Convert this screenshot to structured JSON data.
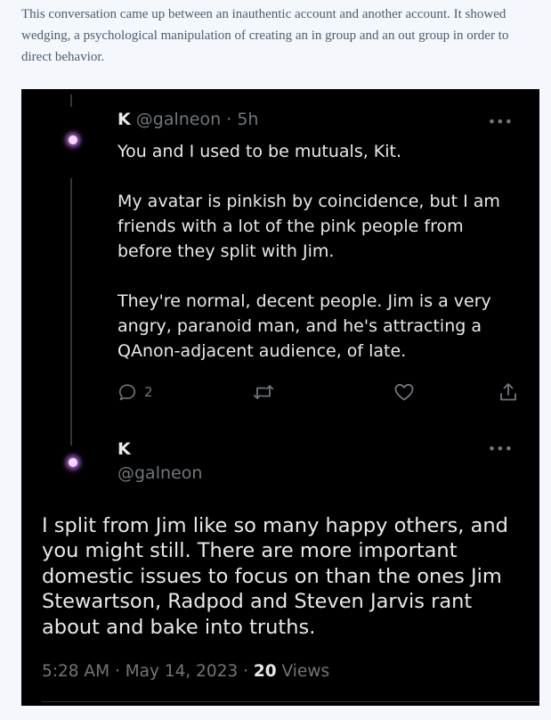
{
  "intro_text": "This conversation came up between an inauthentic account and another account. It showed wedging, a psychological manipulation of creating an in group and an out group in order to direct behavior.",
  "tweet1": {
    "name": "K",
    "handle": "@galneon",
    "separator": "·",
    "time": "5h",
    "more": "•••",
    "paragraphs": [
      "You and I used to be mutuals, Kit.",
      "My avatar is pinkish by coincidence, but I am friends with a lot of the pink people from before they split with Jim.",
      "They're normal, decent people. Jim is a very angry, paranoid man, and he's attracting a QAnon-adjacent audience, of late."
    ],
    "reply_count": "2",
    "icons": [
      "reply-icon",
      "retweet-icon",
      "like-icon",
      "share-icon"
    ]
  },
  "tweet2": {
    "name": "K",
    "handle": "@galneon",
    "more": "•••",
    "text": "I split from Jim like so many happy others, and you might still. There are more important domestic issues to focus on than the ones Jim Stewartson, Radpod and Steven Jarvis rant about and bake into truths.",
    "time": "5:28 AM",
    "separator": "·",
    "date": "May 14, 2023",
    "separator2": "·",
    "views_count": "20",
    "views_label": "Views"
  },
  "colors": {
    "page_bg": "#f4f7fb",
    "intro_text": "#4b5e71",
    "tweet_bg": "#000000",
    "primary_text": "#e7e9ea",
    "secondary_text": "#71767b",
    "avatar_glow": "#cd78ff"
  }
}
